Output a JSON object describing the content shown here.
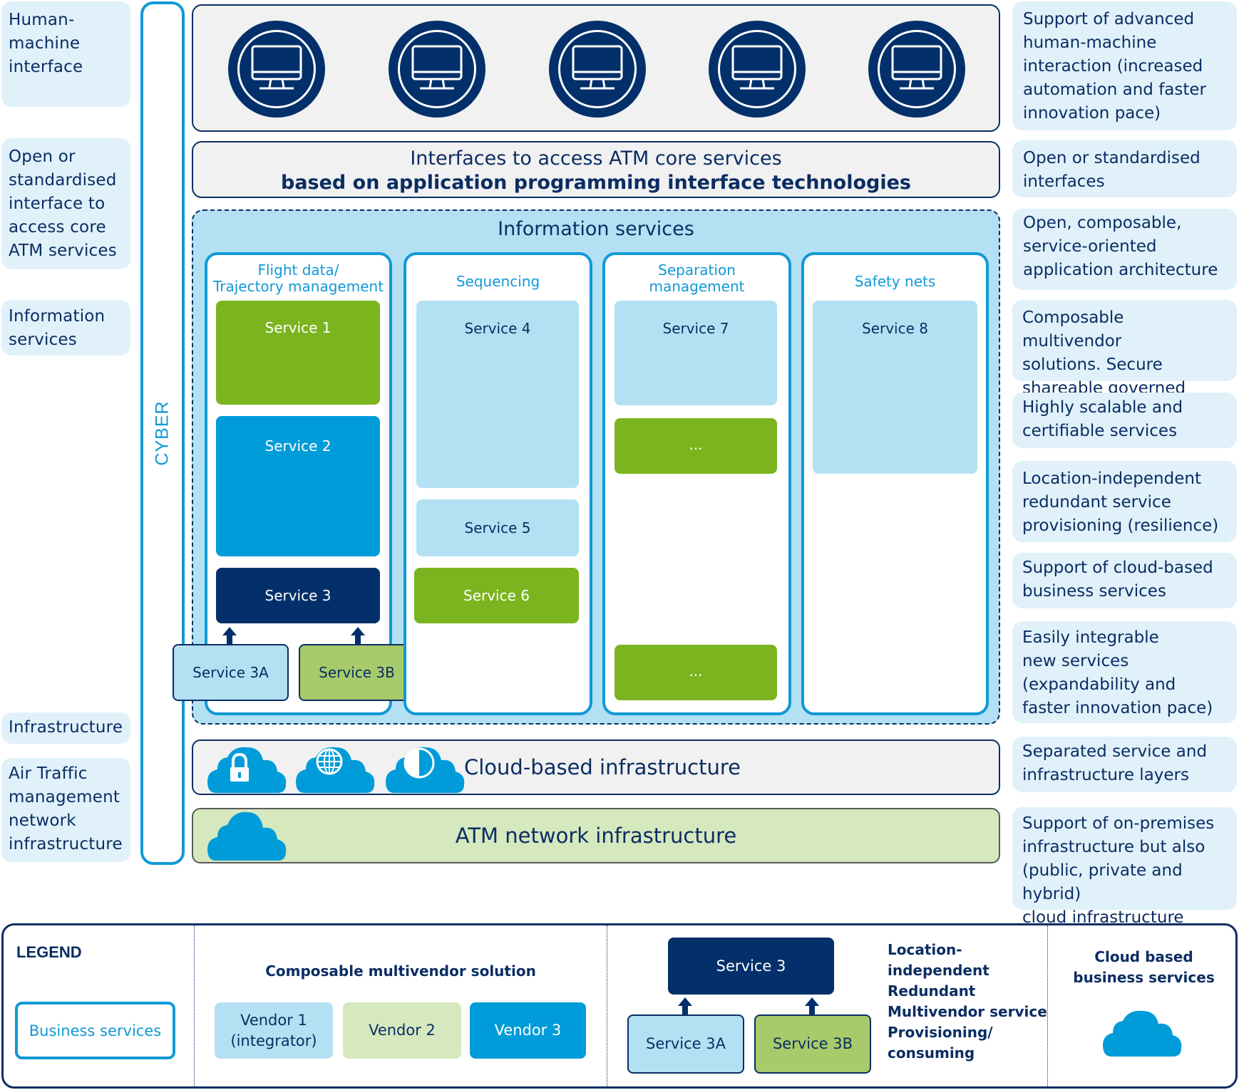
{
  "left_labels": [
    {
      "text": "Human-\nmachine\ninterface"
    },
    {
      "text": "Open or\nstandardised\ninterface to\naccess core\nATM services"
    },
    {
      "text": "Information\nservices"
    },
    {
      "text": "Infrastructure"
    },
    {
      "text": "Air Traffic\nmanagement\nnetwork\ninfrastructure"
    }
  ],
  "cyber_label": "CYBER",
  "hmi": {
    "icon": "monitor-icon",
    "count": 5
  },
  "interfaces": {
    "line1": "Interfaces to access ATM core services",
    "line2": "based on application programming interface technologies"
  },
  "information_services": {
    "title": "Information services",
    "columns": [
      {
        "title": "Flight data/\nTrajectory management",
        "services": [
          {
            "label": "Service 1",
            "vendor": "Vendor 2"
          },
          {
            "label": "Service 2",
            "vendor": "Vendor 3"
          },
          {
            "label": "Service 3",
            "vendor": "redundant"
          }
        ],
        "sub_services": [
          {
            "label": "Service 3A",
            "vendor": "Vendor 1"
          },
          {
            "label": "Service 3B",
            "vendor": "Vendor 2"
          }
        ]
      },
      {
        "title": "Sequencing",
        "services": [
          {
            "label": "Service 4",
            "vendor": "Vendor 1"
          },
          {
            "label": "Service 5",
            "vendor": "Vendor 1"
          },
          {
            "label": "Service 6",
            "vendor": "Vendor 2"
          }
        ]
      },
      {
        "title": "Separation\nmanagement",
        "services": [
          {
            "label": "Service 7",
            "vendor": "Vendor 1"
          },
          {
            "label": "...",
            "vendor": "Vendor 2"
          },
          {
            "label": "...",
            "vendor": "Vendor 2"
          }
        ]
      },
      {
        "title": "Safety nets",
        "services": [
          {
            "label": "Service 8",
            "vendor": "Vendor 1"
          }
        ]
      }
    ]
  },
  "cloud_infrastructure": {
    "label": "Cloud-based infrastructure",
    "icons": [
      "cloud-lock-icon",
      "cloud-globe-icon",
      "cloud-contrast-icon"
    ]
  },
  "atm_network": {
    "label": "ATM network infrastructure",
    "icon": "cloud-icon"
  },
  "right_labels": [
    {
      "text": "Support of advanced\nhuman-machine\ninteraction (increased\nautomation and faster\ninnovation pace)"
    },
    {
      "text": "Open or standardised\ninterfaces"
    },
    {
      "text": "Open, composable,\nservice-oriented\napplication architecture"
    },
    {
      "text": "Composable multivendor\nsolutions. Secure\nshareable governed data"
    },
    {
      "text": "Highly scalable and\ncertifiable services"
    },
    {
      "text": "Location-independent\nredundant service\nprovisioning (resilience)"
    },
    {
      "text": "Support of cloud-based\nbusiness services"
    },
    {
      "text": "Easily integrable\nnew services\n(expandability and\nfaster innovation pace)"
    },
    {
      "text": "Separated service and\ninfrastructure layers"
    },
    {
      "text": "Support of on-premises\ninfrastructure but also\n(public, private and hybrid)\ncloud infrastructure"
    }
  ],
  "legend": {
    "title": "LEGEND",
    "business_services": "Business services",
    "composable_title": "Composable multivendor solution",
    "vendors": [
      {
        "label": "Vendor 1\n(integrator)",
        "color": "#b3e1f3"
      },
      {
        "label": "Vendor 2",
        "color": "#d6e8bd"
      },
      {
        "label": "Vendor 3",
        "color": "#009cd9"
      }
    ],
    "redundant": {
      "service": "Service 3",
      "sub_a": "Service 3A",
      "sub_b": "Service 3B",
      "description": "Location-\nindependent\nRedundant\nMultivendor service\nProvisioning/\nconsuming"
    },
    "cloud_title": "Cloud based\nbusiness services"
  },
  "colors": {
    "navy": "#03306b",
    "cyan": "#1199d6",
    "light_blue": "#b3e1f3",
    "green": "#7bb41f",
    "blue": "#009cd9",
    "label_bg": "#e0f1fa"
  }
}
